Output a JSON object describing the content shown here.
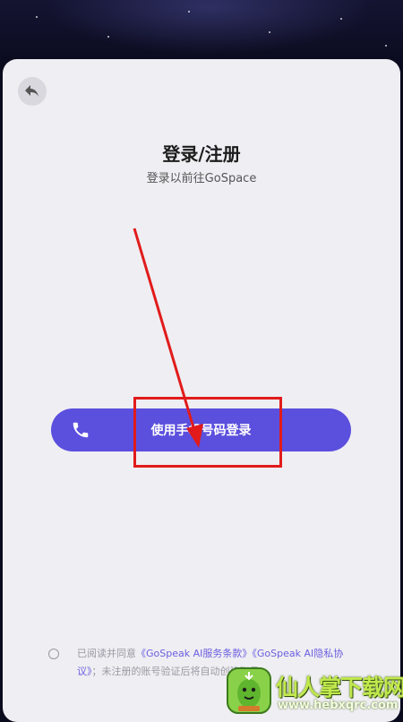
{
  "header": {
    "title": "登录/注册",
    "subtitle": "登录以前往GoSpace"
  },
  "login": {
    "phone_button_label": "使用手机号码登录",
    "phone_icon": "phone-icon"
  },
  "agreement": {
    "prefix": "已阅读并同意",
    "terms_link": "《GoSpeak AI服务条款》",
    "privacy_link": "《GoSpeak AI隐私协议》",
    "suffix": "；未注册的账号验证后将自动创建账号"
  },
  "watermark": {
    "name": "仙人掌下载网",
    "url": "www.hebxqrc.com"
  },
  "colors": {
    "accent": "#5b4fde",
    "link": "#6a5fe0",
    "annotation": "#e11b1b",
    "sheet": "#efeef2"
  }
}
